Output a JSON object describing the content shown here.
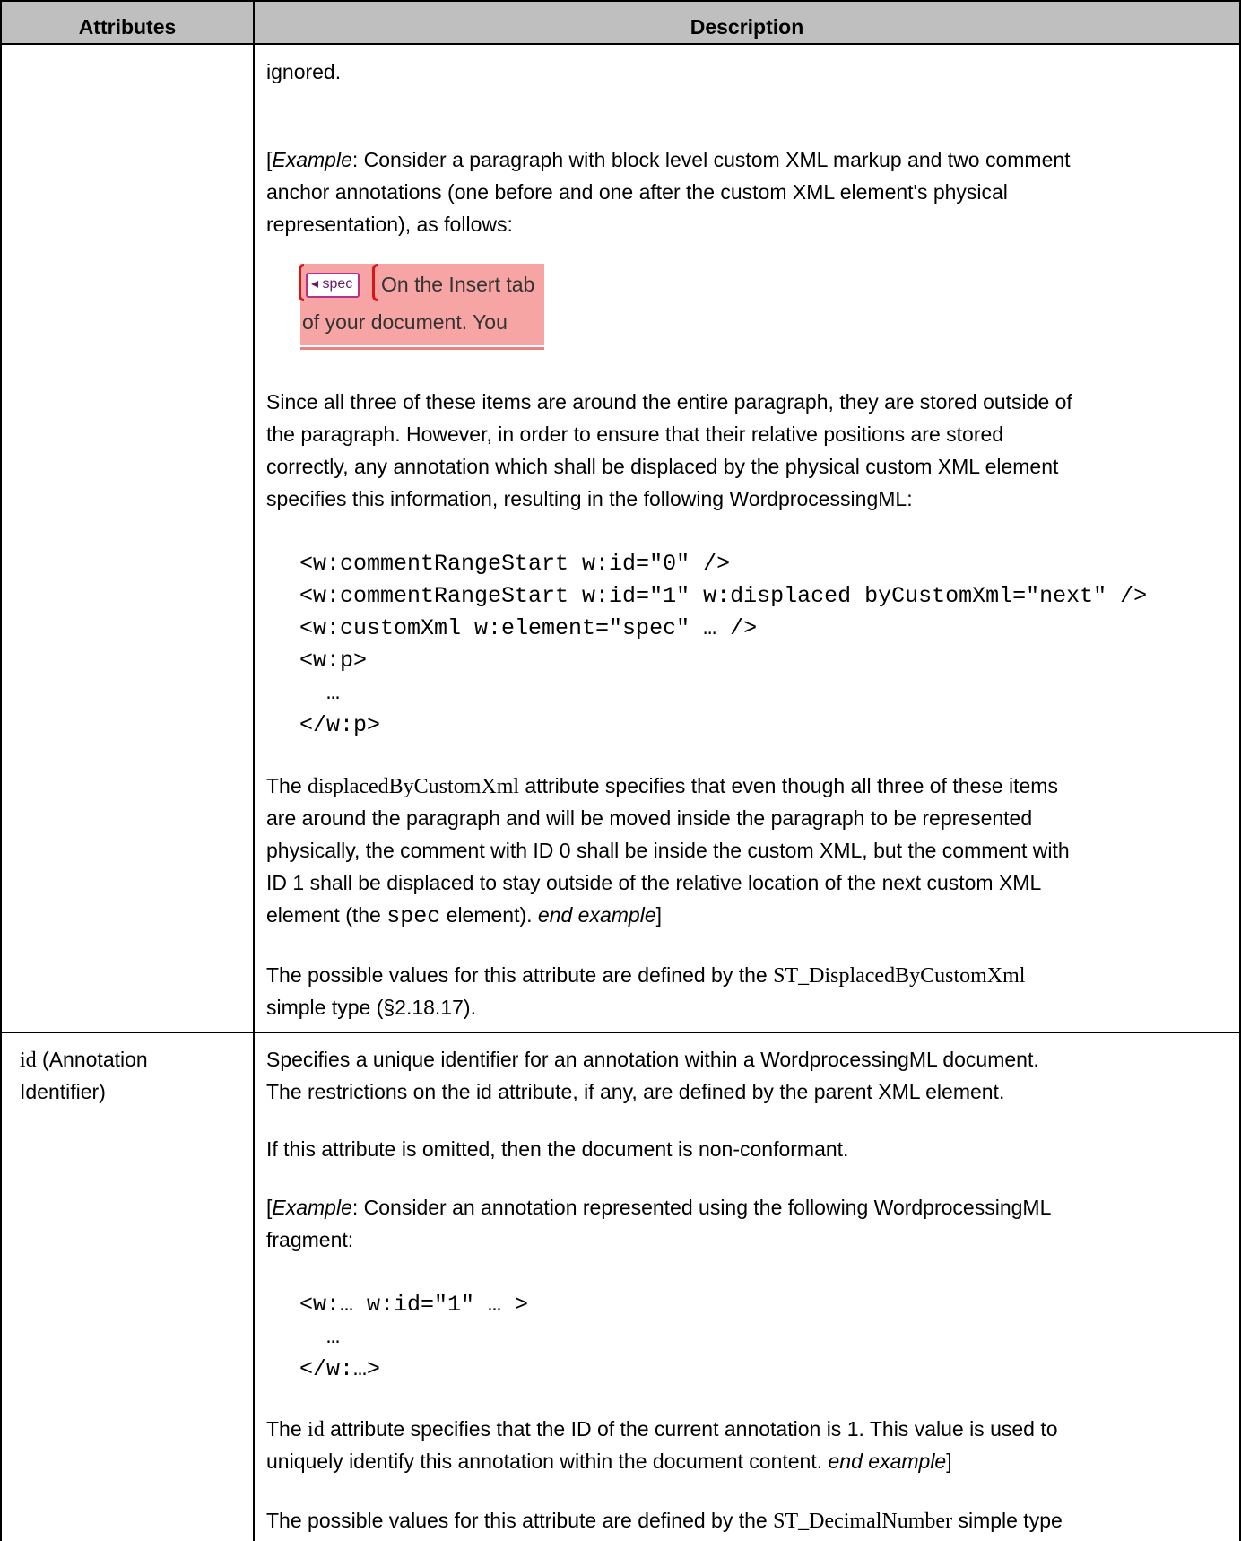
{
  "header": {
    "col1": "Attributes",
    "col2": "Description"
  },
  "row1": {
    "p_ignored": "ignored.",
    "example_open": "[",
    "example_word": "Example",
    "example_l1_rest": ": Consider a paragraph with block level custom XML markup and two comment",
    "example_l2": "anchor annotations (one before and one after the custom XML element's physical",
    "example_l3": "representation), as follows:",
    "mini_tag": "spec",
    "mini_line1": "On the Insert tab",
    "mini_line2": "of your document. You",
    "since_l1": "Since all three of these items are around the entire paragraph, they are stored outside of",
    "since_l2": "the paragraph. However, in order to ensure that their relative positions are stored",
    "since_l3": "correctly, any annotation which shall be displaced by the physical custom XML element",
    "since_l4": "specifies this information, resulting in the following WordprocessingML:",
    "code": [
      "<w:commentRangeStart w:id=\"0\" />",
      "<w:commentRangeStart w:id=\"1\" w:displaced byCustomXml=\"next\" />",
      "<w:customXml w:element=\"spec\" … />",
      "<w:p>",
      "  …",
      "</w:p>"
    ],
    "disp_l1_pre": "The ",
    "disp_l1_term": "displacedByCustomXml",
    "disp_l1_post": " attribute specifies that even though all three of these items",
    "disp_l2": "are around the paragraph and will be moved inside the paragraph to be represented",
    "disp_l3": "physically, the comment with ID 0 shall be inside the custom XML, but the comment with",
    "disp_l4": "ID 1 shall be displaced to stay outside of the relative location of the next custom XML",
    "disp_l5_pre": "element (the ",
    "disp_l5_term": "spec",
    "disp_l5_mid": " element). ",
    "disp_l5_end": "end example",
    "disp_l5_close": "]",
    "poss_l1_pre": "The possible values for this attribute are defined by the ",
    "poss_l1_term": "ST_DisplacedByCustomXml",
    "poss_l2": "simple type (§2.18.17)."
  },
  "row2": {
    "attr_l1_term": "id",
    "attr_l1_rest": " (Annotation",
    "attr_l2": "Identifier)",
    "spec_l1": "Specifies a unique identifier for an annotation within a WordprocessingML document.",
    "spec_l2": "The restrictions on the id attribute, if any, are defined by the parent XML element.",
    "omit": "If this attribute is omitted, then the document is non-conformant.",
    "ex_open": "[",
    "ex_word": "Example",
    "ex_l1_rest": ": Consider an annotation represented using the following WordprocessingML",
    "ex_l2": "fragment:",
    "code": [
      "<w:… w:id=\"1\" … >",
      "  …",
      "</w:…>"
    ],
    "id_l1_pre": "The ",
    "id_l1_term": "id",
    "id_l1_post": " attribute specifies that the ID of the current annotation is 1. This value is used to",
    "id_l2_pre": "uniquely identify this annotation within the document content. ",
    "id_l2_end": "end example",
    "id_l2_close": "]",
    "poss_l1_pre": "The possible values for this attribute are defined by the ",
    "poss_l1_term": "ST_DecimalNumber",
    "poss_l1_post": " simple type"
  }
}
